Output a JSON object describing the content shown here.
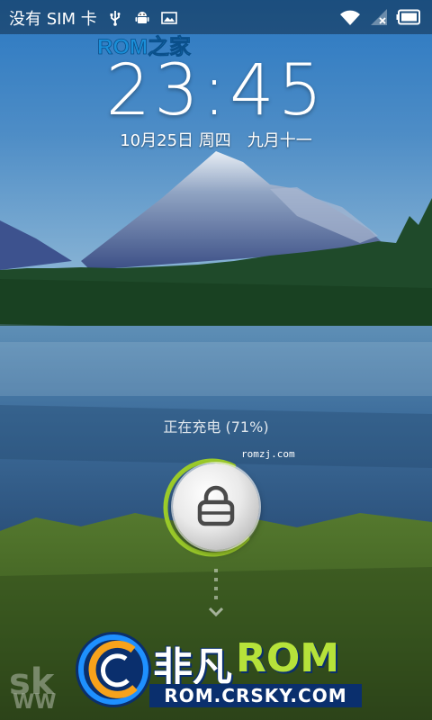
{
  "status_bar": {
    "carrier": "没有 SIM 卡",
    "icons_left": [
      "usb-icon",
      "android-debug-icon",
      "image-notification-icon"
    ],
    "icons_right": [
      "wifi-icon",
      "no-signal-icon",
      "battery-icon"
    ]
  },
  "watermark_top": {
    "text": "ROM之家"
  },
  "lockscreen": {
    "time": "23:45",
    "date": "10月25日 周四　九月十一",
    "charging_status": "正在充电 (71%)",
    "charge_level": 0.71,
    "small_watermark": "romzj.com",
    "unlock_icon": "lock-icon",
    "hint_icon": "chevron-down-icon"
  },
  "watermark_bottom": {
    "brand_cn": "非凡",
    "brand_rom": "ROM",
    "url": "ROM.CRSKY.COM",
    "faded_left_top": "sk",
    "faded_left_bottom": "WW"
  },
  "colors": {
    "sky": "#2f7fc7",
    "lake": "#2c5f94",
    "grass": "#3e6b1f",
    "ring_accent": "#9ccc2a",
    "watermark_navy": "#0a2f6d",
    "watermark_green": "#b6e23a"
  }
}
